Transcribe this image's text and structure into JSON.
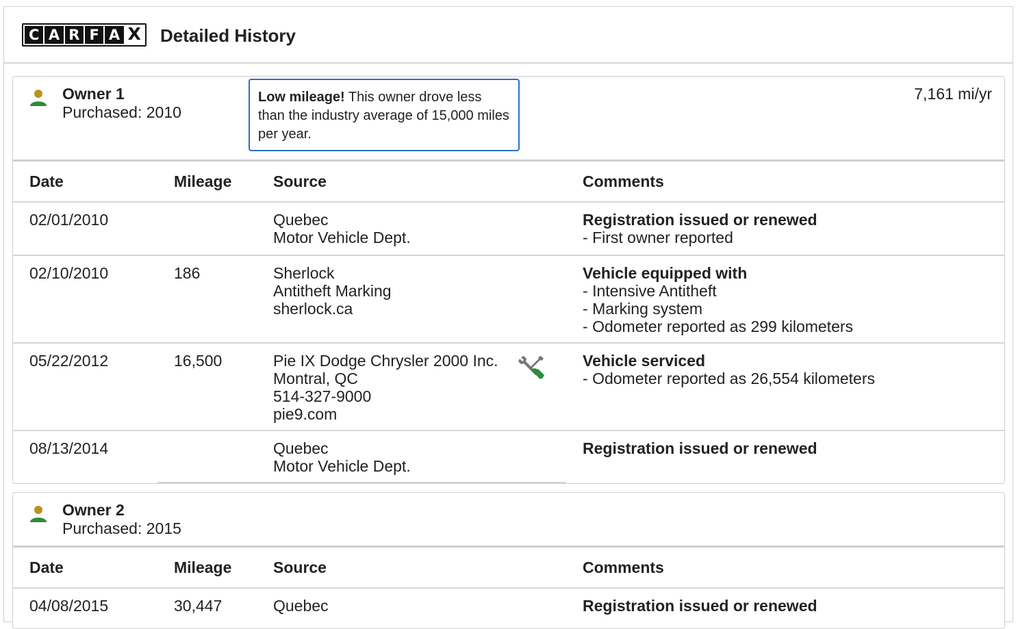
{
  "header": {
    "logo_letters": [
      "C",
      "A",
      "R",
      "F",
      "A",
      "X"
    ],
    "title": "Detailed History"
  },
  "columns": {
    "date": "Date",
    "mileage": "Mileage",
    "source": "Source",
    "comments": "Comments"
  },
  "owners": [
    {
      "name": "Owner 1",
      "purchased": "Purchased: 2010",
      "note_bold": "Low mileage!",
      "note_text": " This owner drove less than the industry average of 15,000 miles per year.",
      "miles_per_year": "7,161 mi/yr",
      "records": [
        {
          "date": "02/01/2010",
          "mileage": "",
          "source": [
            "Quebec",
            "Motor Vehicle Dept."
          ],
          "comment_title": "Registration issued or renewed",
          "comment_lines": [
            "First owner reported"
          ]
        },
        {
          "date": "02/10/2010",
          "mileage": "186",
          "source": [
            "Sherlock",
            "Antitheft Marking",
            "sherlock.ca"
          ],
          "comment_title": "Vehicle equipped with",
          "comment_lines": [
            "Intensive Antitheft",
            "Marking system",
            "Odometer reported as 299 kilometers"
          ]
        },
        {
          "date": "05/22/2012",
          "mileage": "16,500",
          "source": [
            "Pie IX Dodge Chrysler 2000 Inc.",
            "Montral, QC",
            "514-327-9000",
            "pie9.com"
          ],
          "icon": "wrench-screwdriver-icon",
          "comment_title": "Vehicle serviced",
          "comment_lines": [
            "Odometer reported as 26,554 kilometers"
          ]
        },
        {
          "date": "08/13/2014",
          "mileage": "",
          "source": [
            "Quebec",
            "Motor Vehicle Dept."
          ],
          "comment_title": "Registration issued or renewed",
          "comment_lines": []
        }
      ]
    },
    {
      "name": "Owner 2",
      "purchased": "Purchased: 2015",
      "records": [
        {
          "date": "04/08/2015",
          "mileage": "30,447",
          "source": [
            "Quebec"
          ],
          "comment_title": "Registration issued or renewed",
          "comment_lines": []
        }
      ]
    }
  ],
  "colors": {
    "accent_blue": "#2a6ec8",
    "owner_head": "#b8941f",
    "owner_body": "#2e8b3a",
    "border": "#cfcfcf"
  }
}
